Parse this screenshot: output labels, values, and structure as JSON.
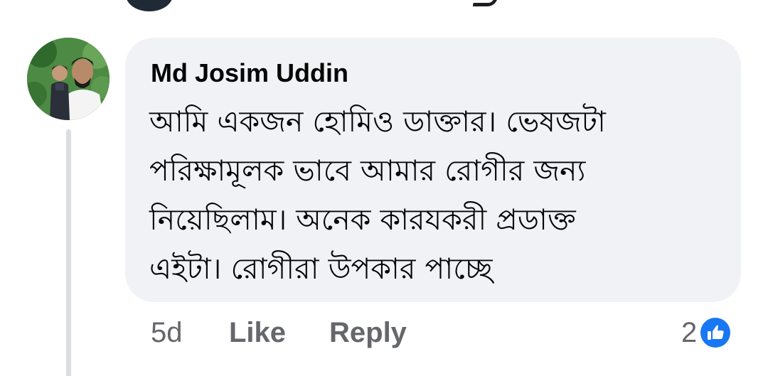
{
  "comment": {
    "author": "Md Josim Uddin",
    "text_lines": [
      "আমি একজন হোমিও ডাক্তার। ভেষজটা",
      "পরিক্ষামূলক ভাবে আমার রোগীর জন্য",
      "নিয়েছিলাম। অনেক কারযকরী প্রডাক্ত",
      "এইটা। রোগীরা উপকার পাচ্ছে"
    ],
    "time": "5d",
    "like_label": "Like",
    "reply_label": "Reply",
    "reaction_count": "2",
    "reaction_icon": "like-thumb-icon"
  },
  "colors": {
    "bubble": "#f0f2f5",
    "secondary_text": "#65676b",
    "like_blue": "#1877f2"
  }
}
